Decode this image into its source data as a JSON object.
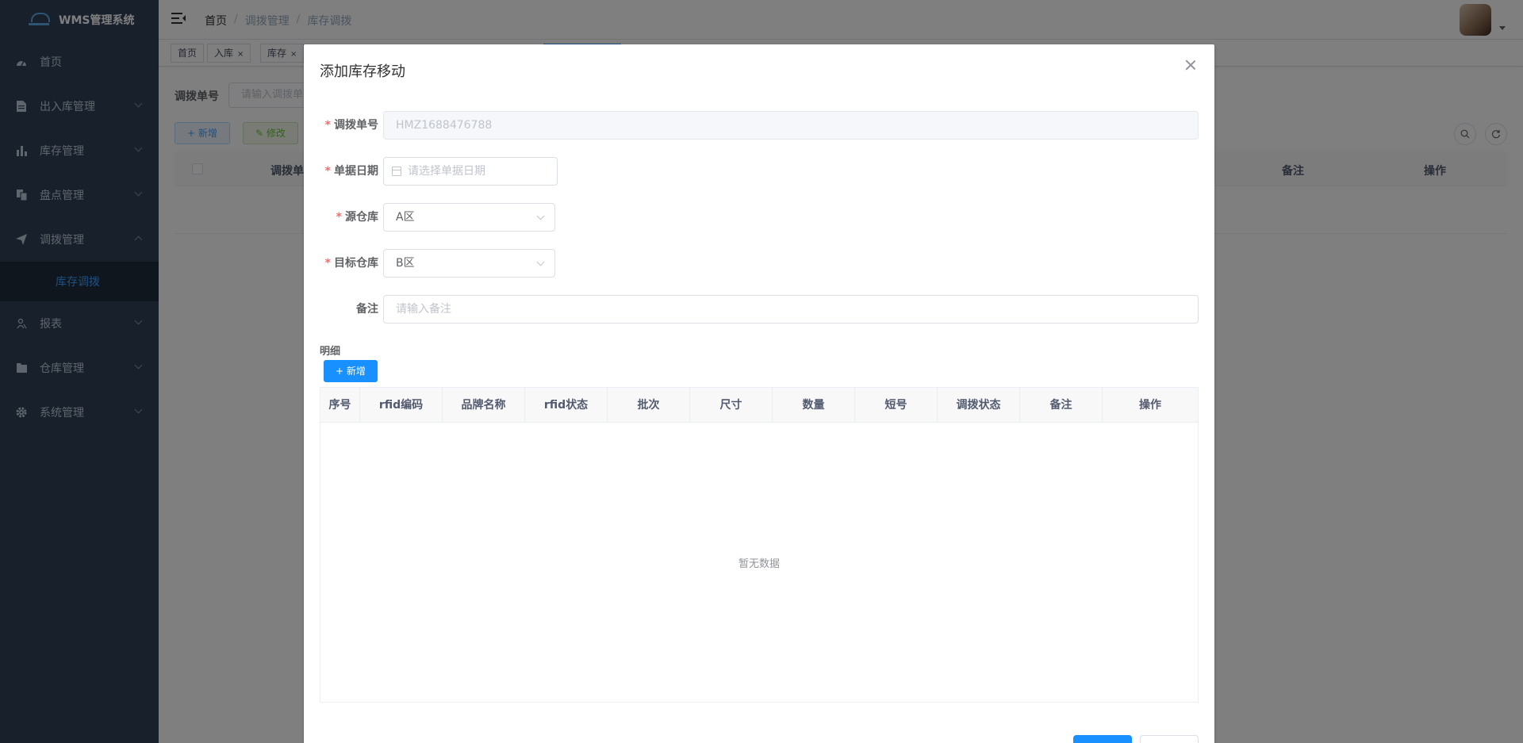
{
  "app": {
    "title": "WMS管理系统"
  },
  "sidebar": {
    "items": [
      {
        "label": "首页",
        "icon": "dashboard-icon"
      },
      {
        "label": "出入库管理",
        "icon": "document-icon"
      },
      {
        "label": "库存管理",
        "icon": "bar-chart-icon"
      },
      {
        "label": "盘点管理",
        "icon": "copy-icon"
      },
      {
        "label": "调拨管理",
        "icon": "send-icon",
        "expanded": true,
        "children": [
          {
            "label": "库存调拨",
            "active": true
          }
        ]
      },
      {
        "label": "报表",
        "icon": "people-icon"
      },
      {
        "label": "仓库管理",
        "icon": "folder-icon"
      },
      {
        "label": "系统管理",
        "icon": "gear-icon"
      }
    ]
  },
  "navbar": {
    "breadcrumb": [
      "首页",
      "调拨管理",
      "库存调拨"
    ],
    "separator": "/"
  },
  "tags": [
    {
      "label": "首页",
      "closable": false
    },
    {
      "label": "入库",
      "closable": true
    },
    {
      "label": "库存",
      "closable": true
    }
  ],
  "page": {
    "search_label": "调拨单号",
    "search_placeholder": "请输入调拨单号",
    "add_button": "+ 新增",
    "edit_button": "✎ 修改",
    "columns": [
      "调拨单号",
      "备注",
      "操作"
    ]
  },
  "dialog": {
    "title": "添加库存移动",
    "fields": {
      "order_no": {
        "label": "调拨单号",
        "required": true,
        "value": "HMZ1688476788"
      },
      "date": {
        "label": "单据日期",
        "required": true,
        "placeholder": "请选择单据日期"
      },
      "source": {
        "label": "源仓库",
        "required": true,
        "value": "A区"
      },
      "target": {
        "label": "目标仓库",
        "required": true,
        "value": "B区"
      },
      "remark": {
        "label": "备注",
        "required": false,
        "placeholder": "请输入备注"
      }
    },
    "detail_label": "明细",
    "detail_add": "+ 新增",
    "columns": [
      "序号",
      "rfid编码",
      "品牌名称",
      "rfid状态",
      "批次",
      "尺寸",
      "数量",
      "短号",
      "调拨状态",
      "备注",
      "操作"
    ],
    "empty_text": "暂无数据"
  },
  "colors": {
    "sidebar_bg": "#304156",
    "primary": "#1890ff",
    "active_menu": "#409eff",
    "required": "#f56c6c"
  }
}
